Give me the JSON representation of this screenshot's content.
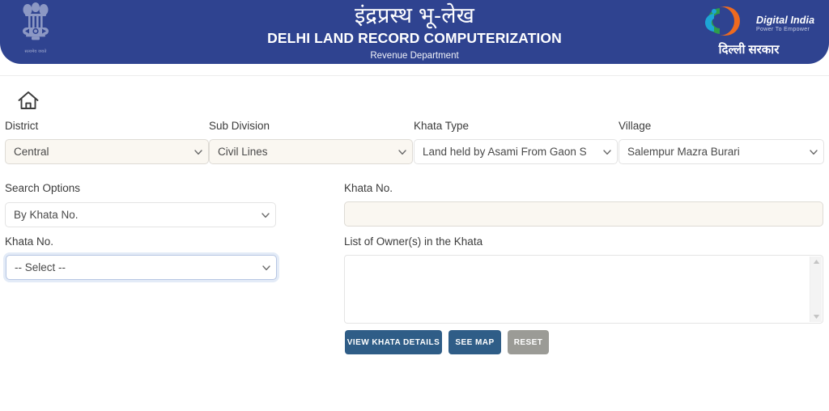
{
  "header": {
    "title_hi": "इंद्रप्रस्थ भू-लेख",
    "title_en": "DELHI LAND RECORD COMPUTERIZATION",
    "subtitle": "Revenue Department",
    "emblem_motto": "सत्यमेव जयते",
    "emblem_icon": "india-state-emblem-icon",
    "digital_india": {
      "name": "Digital India",
      "tagline": "Power To Empower",
      "govt_label": "दिल्ली सरकार",
      "logo_icon": "digital-india-logo-icon"
    },
    "bg_color": "#2f4390"
  },
  "nav": {
    "home_icon": "home-icon"
  },
  "filters": [
    {
      "label": "District",
      "value": "Central",
      "name": "district"
    },
    {
      "label": "Sub Division",
      "value": "Civil Lines",
      "name": "sub-division"
    },
    {
      "label": "Khata Type",
      "value": "Land held by Asami From Gaon S",
      "name": "khata-type"
    },
    {
      "label": "Village",
      "value": "Salempur Mazra Burari",
      "name": "village"
    }
  ],
  "search": {
    "options_label": "Search Options",
    "options_value": "By Khata No.",
    "khata_no_label": "Khata No.",
    "khata_no_value": "-- Select --"
  },
  "details": {
    "khata_no_label": "Khata No.",
    "khata_no_value": "",
    "owners_label": "List of Owner(s) in the Khata",
    "owners_value": ""
  },
  "buttons": {
    "view_khata": "VIEW KHATA DETAILS",
    "see_map": "SEE MAP",
    "reset": "RESET",
    "primary_color": "#2f5d87",
    "muted_color": "#9b9b96"
  },
  "icons": {
    "chevron_down": "chevron-down-icon",
    "scroll_up": "scroll-up-arrow-icon",
    "scroll_down": "scroll-down-arrow-icon"
  }
}
